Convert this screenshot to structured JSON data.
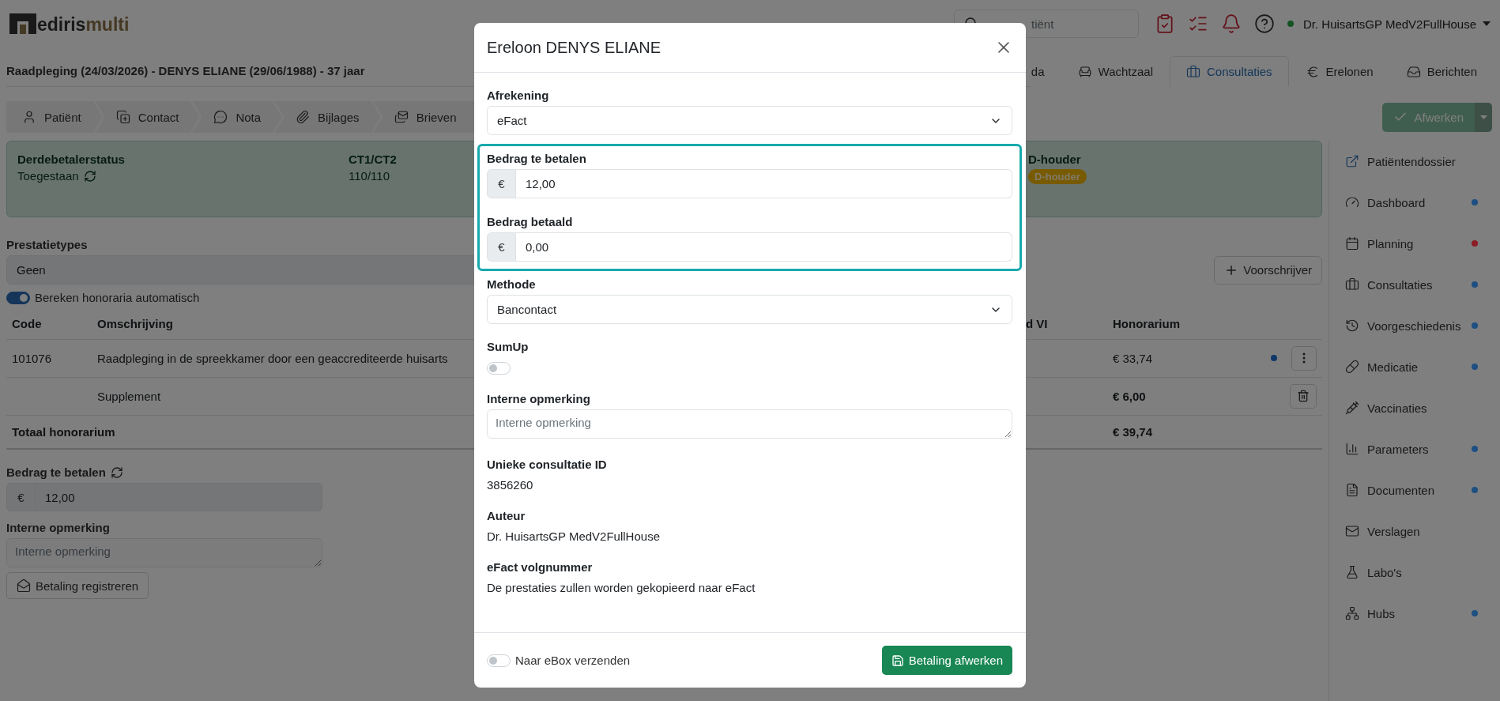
{
  "header": {
    "logo_text": "ediris",
    "logo_accent": "multi",
    "search": {
      "placeholder": "tiënt"
    },
    "user": {
      "name": "Dr. HuisartsGP MedV2FullHouse",
      "online": true
    }
  },
  "page_title": "Raadpleging (24/03/2026) - DENYS ELIANE (29/06/1988) - 37 jaar",
  "nav_tabs": [
    {
      "label": "da",
      "selected": false
    },
    {
      "label": "Wachtzaal",
      "selected": false
    },
    {
      "label": "Consultaties",
      "selected": true
    },
    {
      "label": "Erelonen",
      "selected": false
    },
    {
      "label": "Berichten",
      "selected": false
    }
  ],
  "steps": [
    "Patiënt",
    "Contact",
    "Nota",
    "Bijlages",
    "Brieven"
  ],
  "finish_button": {
    "label": "Afwerken",
    "disabled": true
  },
  "status_card": [
    {
      "kind": "refresh",
      "label": "Derdebetalerstatus",
      "value": "Toegestaan"
    },
    {
      "kind": "text",
      "label": "CT1/CT2",
      "value": "110/110"
    },
    {
      "kind": "badge",
      "label": "D-houder",
      "value": "D-houder"
    }
  ],
  "prestatietypes": {
    "label": "Prestatietypes",
    "value": "Geen"
  },
  "prescriber_button": "Voorschrijver",
  "auto_toggle": {
    "label": "Bereken honoraria automatisch",
    "on": true
  },
  "table": {
    "columns": [
      "Code",
      "Omschrijving",
      "d VI",
      "Honorarium"
    ],
    "rows": [
      {
        "code": "101076",
        "description": "Raadpleging in de spreekkamer door een geaccrediteerde huisarts",
        "fee": "€ 33,74",
        "bold": false,
        "dot": true,
        "kind": "menu"
      },
      {
        "description": "Supplement",
        "fee": "€ 6,00",
        "bold": true,
        "dot": false,
        "kind": "delete"
      }
    ],
    "total": {
      "label": "Totaal honorarium",
      "fee": "€ 39,74"
    }
  },
  "payment": {
    "amount_label": "Bedrag te betalen",
    "currency": "€",
    "amount": "12,00",
    "note_label": "Interne opmerking",
    "note_placeholder": "Interne opmerking",
    "register_button": "Betaling registreren"
  },
  "sidebar": [
    {
      "label": "Patiëntendossier"
    },
    {
      "label": "Dashboard",
      "color": "#1e4f82"
    },
    {
      "label": "Planning",
      "color": "#8c1d26"
    },
    {
      "label": "Consultaties",
      "color": "#1e4f82"
    },
    {
      "label": "Voorgeschiedenis",
      "color": "#1e4f82"
    },
    {
      "label": "Medicatie",
      "color": "#1e4f82"
    },
    {
      "label": "Vaccinaties"
    },
    {
      "label": "Parameters",
      "color": "#1e4f82"
    },
    {
      "label": "Documenten",
      "color": "#1e4f82"
    },
    {
      "label": "Verslagen"
    },
    {
      "label": "Labo's"
    },
    {
      "label": "Hubs",
      "color": "#1e4f82"
    }
  ],
  "modal": {
    "title": "Ereloon DENYS ELIANE",
    "settlement": {
      "label": "Afrekening",
      "value": "eFact"
    },
    "amount_highlighted": true,
    "amount_due": {
      "label": "Bedrag te betalen",
      "currency": "€",
      "value": "12,00"
    },
    "amount_paid": {
      "label": "Bedrag betaald",
      "currency": "€",
      "value": "0,00"
    },
    "method": {
      "label": "Methode",
      "value": "Bancontact"
    },
    "sumup": {
      "label": "SumUp",
      "on": false
    },
    "note": {
      "label": "Interne opmerking",
      "placeholder": "Interne opmerking"
    },
    "info": [
      {
        "label": "Unieke consultatie ID",
        "value": "3856260"
      },
      {
        "label": "Auteur",
        "value": "Dr. HuisartsGP MedV2FullHouse"
      },
      {
        "label": "eFact volgnummer",
        "value": "De prestaties zullen worden gekopieerd naar eFact"
      }
    ],
    "ebox": {
      "label": "Naar eBox verzenden",
      "on": false
    },
    "submit_button": "Betaling afwerken"
  }
}
